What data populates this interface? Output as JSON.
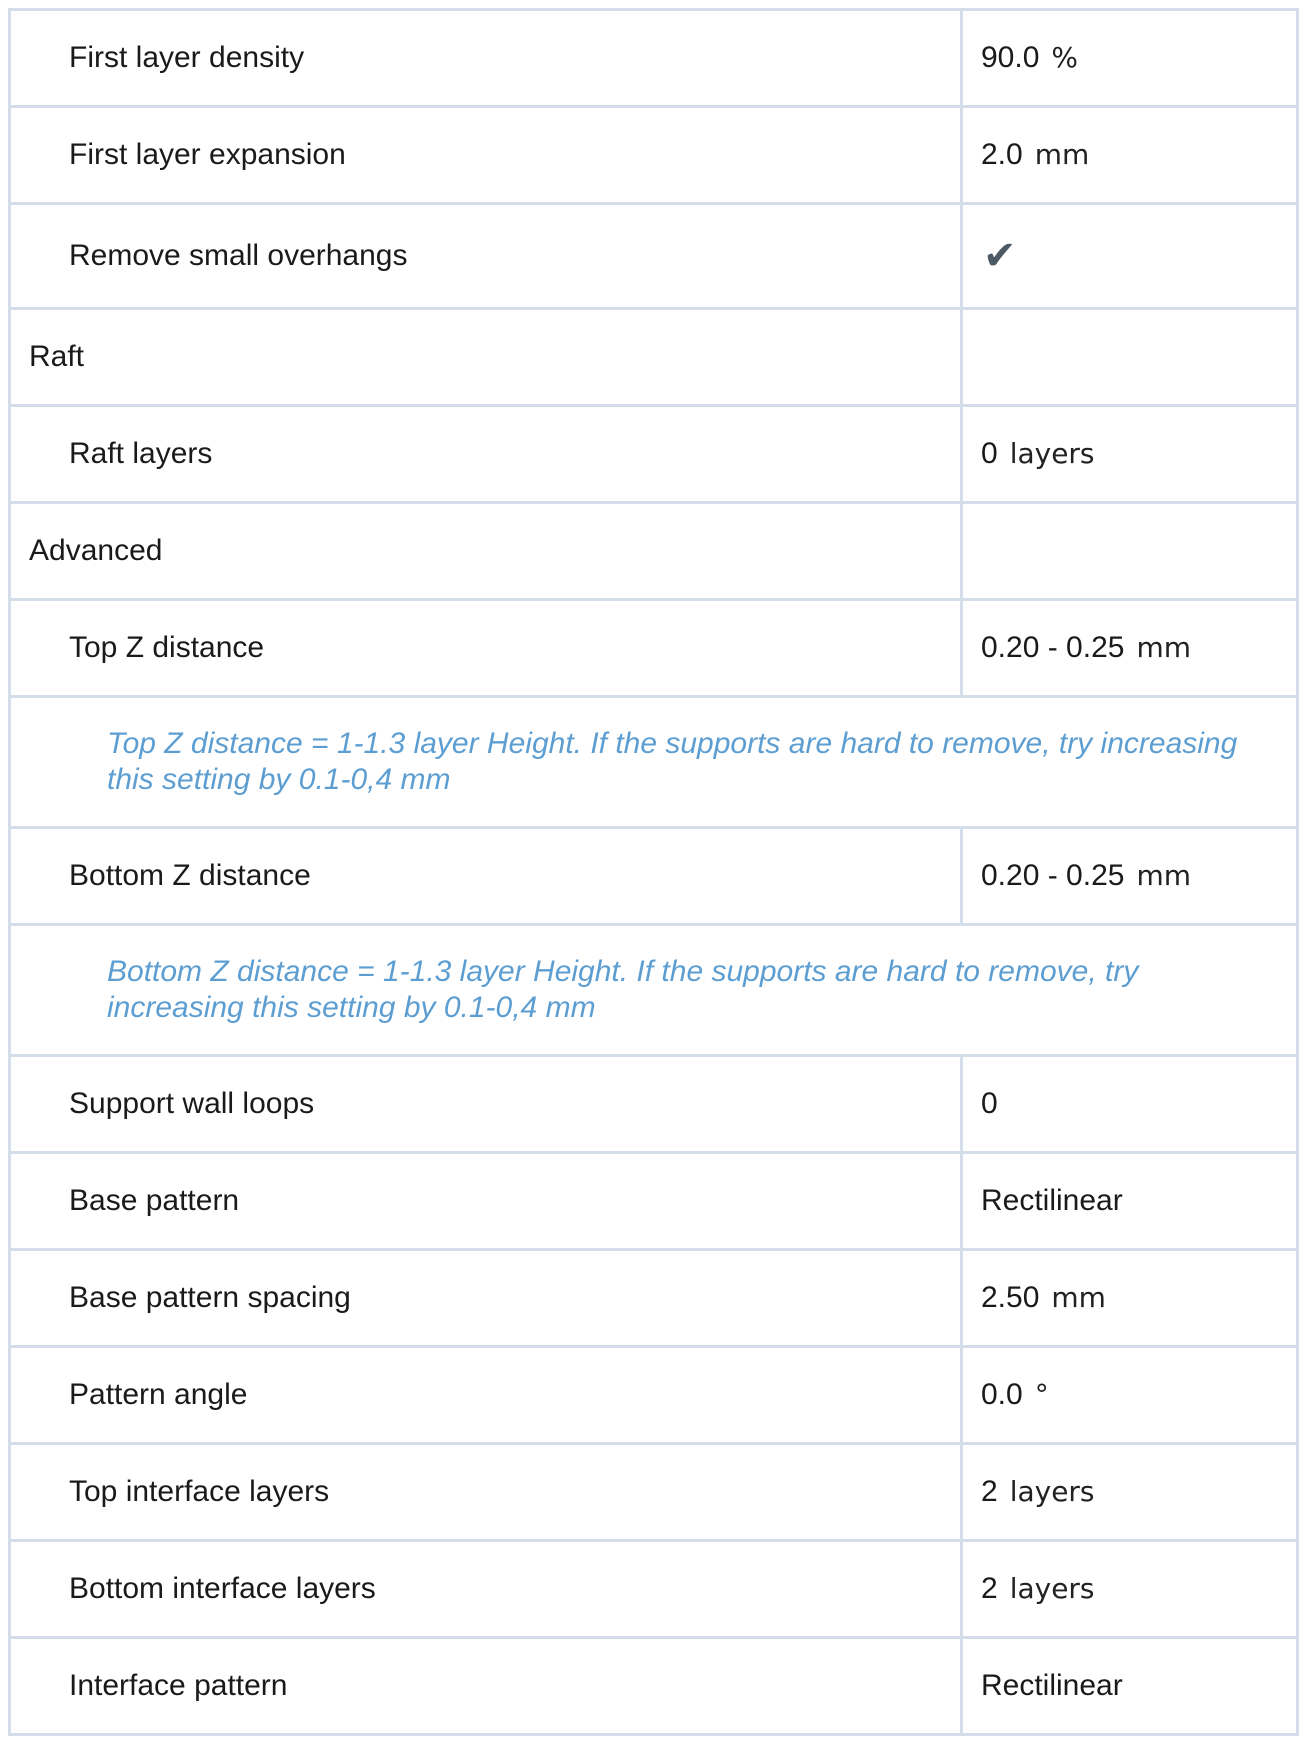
{
  "settings": {
    "rows": [
      {
        "kind": "setting",
        "label": "First layer density",
        "value": "90.0",
        "unit": "%"
      },
      {
        "kind": "setting",
        "label": "First layer expansion",
        "value": "2.0",
        "unit": "mm"
      },
      {
        "kind": "setting",
        "label": "Remove small overhangs",
        "value_icon": "checkmark-icon",
        "value_glyph": "✔"
      },
      {
        "kind": "section",
        "label": "Raft"
      },
      {
        "kind": "setting",
        "label": "Raft layers",
        "value": "0",
        "unit": "layers"
      },
      {
        "kind": "section",
        "label": "Advanced"
      },
      {
        "kind": "setting",
        "label": "Top Z distance",
        "value": "0.20 - 0.25",
        "unit": "mm"
      },
      {
        "kind": "note",
        "text": "Top Z distance = 1-1.3 layer Height. If the supports are hard to remove, try increasing this setting by 0.1-0,4 mm"
      },
      {
        "kind": "setting",
        "label": "Bottom Z distance",
        "value": "0.20 - 0.25",
        "unit": "mm"
      },
      {
        "kind": "note",
        "text": "Bottom Z distance = 1-1.3 layer Height. If the supports are hard to remove, try increasing this setting by 0.1-0,4 mm"
      },
      {
        "kind": "setting",
        "label": "Support wall loops",
        "value": "0"
      },
      {
        "kind": "setting",
        "label": "Base pattern",
        "value": "Rectilinear"
      },
      {
        "kind": "setting",
        "label": "Base pattern spacing",
        "value": "2.50",
        "unit": "mm"
      },
      {
        "kind": "setting",
        "label": "Pattern angle",
        "value": "0.0",
        "unit": "°"
      },
      {
        "kind": "setting",
        "label": "Top interface layers",
        "value": "2",
        "unit": "layers"
      },
      {
        "kind": "setting",
        "label": "Bottom interface layers",
        "value": "2",
        "unit": "layers"
      },
      {
        "kind": "setting",
        "label": "Interface pattern",
        "value": "Rectilinear"
      }
    ]
  },
  "colors": {
    "border": "#d3deea",
    "note_text": "#5d9ed2",
    "checkmark": "#4d5965"
  }
}
